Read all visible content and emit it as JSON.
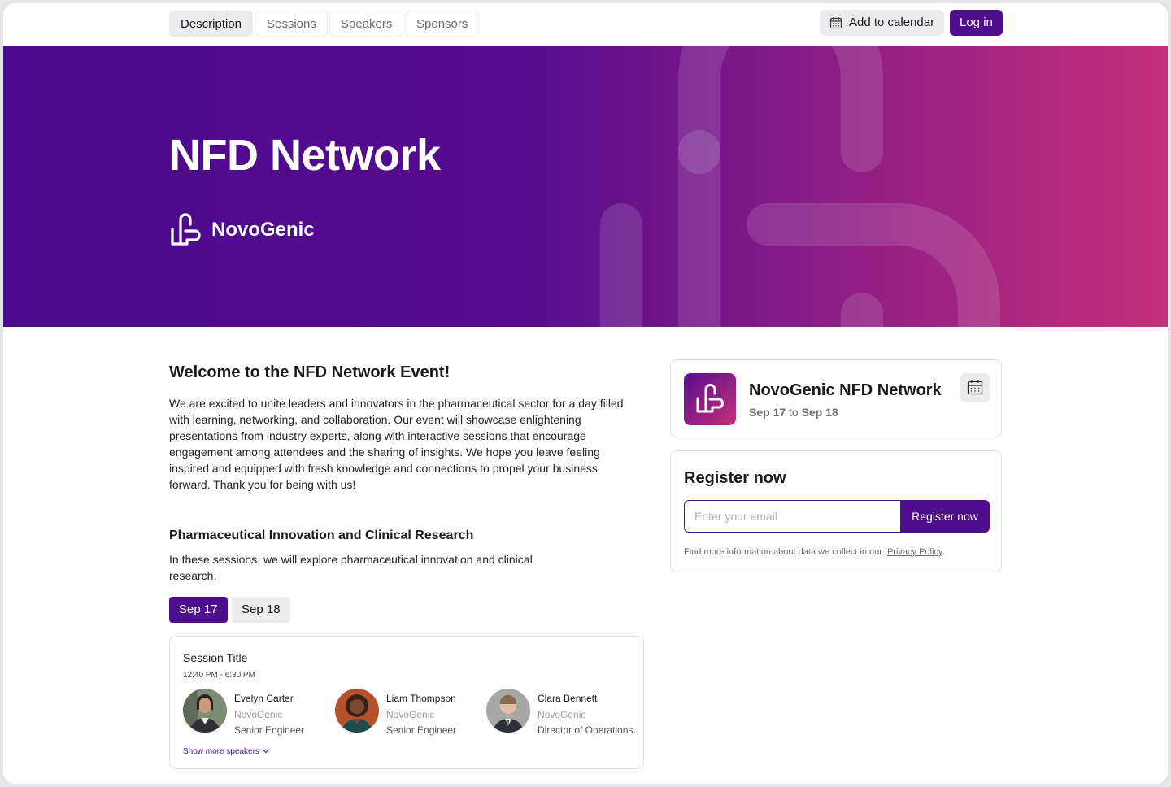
{
  "nav": {
    "tabs": [
      "Description",
      "Sessions",
      "Speakers",
      "Sponsors"
    ],
    "add_to_calendar": "Add to calendar",
    "login": "Log in"
  },
  "hero": {
    "title": "NFD Network",
    "brand": "NovoGenic"
  },
  "welcome": {
    "title": "Welcome to the NFD Network Event!",
    "body": "We are excited to unite leaders and innovators in the pharmaceutical sector for a day filled with learning, networking, and collaboration. Our event will showcase enlightening presentations from industry experts, along with interactive sessions that encourage engagement among attendees and the sharing of insights. We hope you leave feeling inspired and equipped with fresh knowledge and connections to propel your business forward. Thank you for being with us!"
  },
  "section": {
    "title": "Pharmaceutical Innovation and Clinical Research",
    "body": "In these sessions, we will explore pharmaceutical innovation and clinical research.",
    "dates": [
      "Sep 17",
      "Sep 18"
    ]
  },
  "session": {
    "title": "Session Title",
    "time": "12:40 PM - 6:30 PM",
    "speakers": [
      {
        "name": "Evelyn Carter",
        "org": "NovoGenic",
        "role": "Senior Engineer"
      },
      {
        "name": "Liam Thompson",
        "org": "NovoGenic",
        "role": "Senior Engineer"
      },
      {
        "name": "Clara Bennett",
        "org": "NovoGenic",
        "role": "Director of Operations"
      }
    ],
    "show_more": "Show more speakers"
  },
  "event": {
    "name": "NovoGenic NFD Network",
    "start": "Sep 17",
    "to": "to",
    "end": "Sep 18"
  },
  "register": {
    "title": "Register now",
    "placeholder": "Enter your email",
    "button": "Register now",
    "note": "Find more information about data we collect in our",
    "privacy_link": "Privacy Policy",
    "period": "."
  },
  "colors": {
    "brand": "#4f0e8c",
    "hero_start": "#4b0a8f",
    "hero_end": "#c4307a"
  }
}
